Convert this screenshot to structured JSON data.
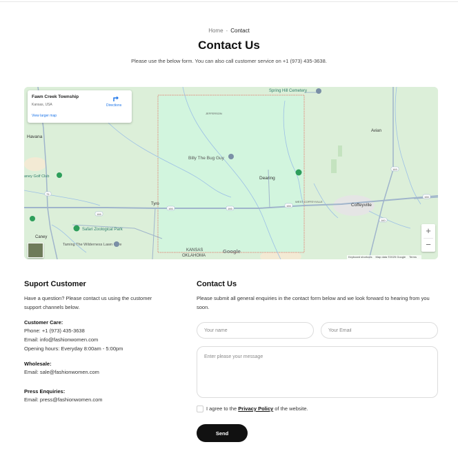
{
  "breadcrumb": {
    "home": "Home",
    "separator": "-",
    "current": "Contact"
  },
  "page": {
    "title": "Contact Us",
    "subtitle": "Please use the below form. You can also call customer service on +1 (973) 435-3638."
  },
  "map": {
    "card": {
      "place": "Fawn Creek Township",
      "region": "Kansas, USA",
      "directions": "Directions",
      "larger_map": "View larger map"
    },
    "labels": {
      "spring_hill": "Spring Hill Cemetery",
      "jefferson": "JEFFERSON",
      "havana": "Havana",
      "golf": "aney Golf Club",
      "bug_guy": "Billy The Bug Guy",
      "dearing": "Dearing",
      "tyro": "Tyro",
      "west_coffeyville": "WEST COFFEYVILLE",
      "coffeyville": "Coffeyville",
      "avian": "Avian",
      "safari": "Safari Zoological Park",
      "caney": "Caney",
      "taming": "Taming The Wilderness Lawn Care",
      "kansas": "KANSAS",
      "oklahoma": "OKLAHOMA",
      "google": "Google",
      "road_166": "166",
      "road_75": "75",
      "road_169": "169",
      "road_160": "160"
    },
    "zoom_in": "+",
    "zoom_out": "−",
    "attribution": {
      "shortcuts": "Keyboard shortcuts",
      "data": "Map data ©2025 Google",
      "terms": "Terms"
    },
    "colors": {
      "land": "#dcefd9",
      "highlight": "#d2f5de",
      "border": "#e08a7a",
      "road": "#9fb4cb",
      "water": "#9cc0e6"
    }
  },
  "support": {
    "heading": "Suport Customer",
    "intro": "Have a question? Please contact us using the customer support channels below.",
    "care_label": "Customer Care:",
    "care_phone": "Phone: +1 (973) 435-3638",
    "care_email": "Email: info@fashionwomen.com",
    "care_hours": "Opening hours: Everyday 8:00am - 5:00pm",
    "wholesale_label": "Wholesale:",
    "wholesale_email": "Email: sale@fashionwomen.com",
    "press_label": "Press Enquiries:",
    "press_email": "Email: press@fashionwomen.com"
  },
  "form": {
    "heading": "Contact Us",
    "intro": "Please submit all general enquiries in the contact form below and we look forward to hearing from you soon.",
    "name_placeholder": "Your name",
    "email_placeholder": "Your Email",
    "message_placeholder": "Enter please your message",
    "agree_prefix": "I agree to the",
    "privacy_link": "Privacy Policy",
    "agree_suffix": "of the website.",
    "send_label": "Send"
  }
}
